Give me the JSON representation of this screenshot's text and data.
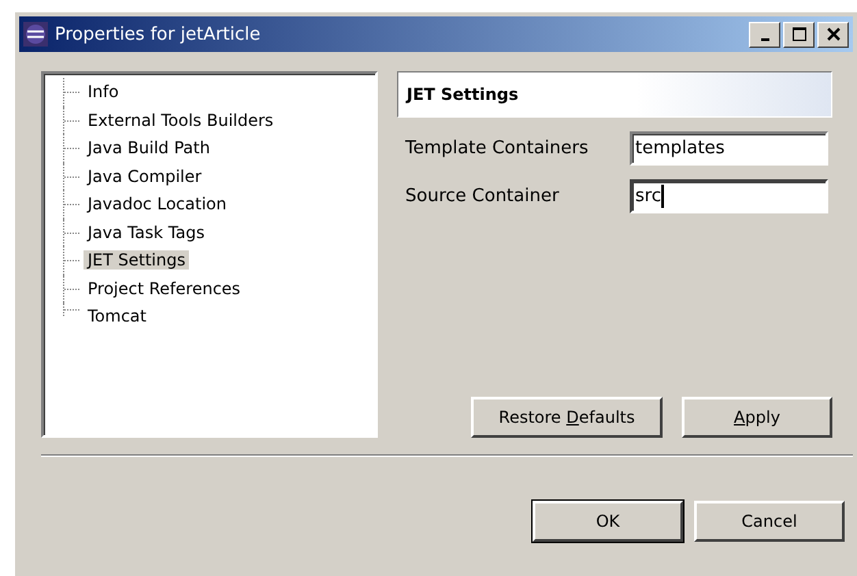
{
  "window": {
    "title": "Properties for jetArticle"
  },
  "tree": {
    "items": [
      {
        "label": "Info",
        "selected": false
      },
      {
        "label": "External Tools Builders",
        "selected": false
      },
      {
        "label": "Java Build Path",
        "selected": false
      },
      {
        "label": "Java Compiler",
        "selected": false
      },
      {
        "label": "Javadoc Location",
        "selected": false
      },
      {
        "label": "Java Task Tags",
        "selected": false
      },
      {
        "label": "JET Settings",
        "selected": true
      },
      {
        "label": "Project References",
        "selected": false
      },
      {
        "label": "Tomcat",
        "selected": false
      }
    ]
  },
  "page": {
    "title": "JET Settings",
    "fields": [
      {
        "label": "Template Containers",
        "value": "templates",
        "focused": false
      },
      {
        "label": "Source Container",
        "value": "src",
        "focused": true
      }
    ],
    "buttons": [
      {
        "before": "Restore ",
        "key": "D",
        "after": "efaults"
      },
      {
        "key": "A",
        "after": "pply"
      }
    ]
  },
  "buttons": [
    {
      "label": "OK",
      "default": true
    },
    {
      "label": "Cancel",
      "default": false
    }
  ]
}
